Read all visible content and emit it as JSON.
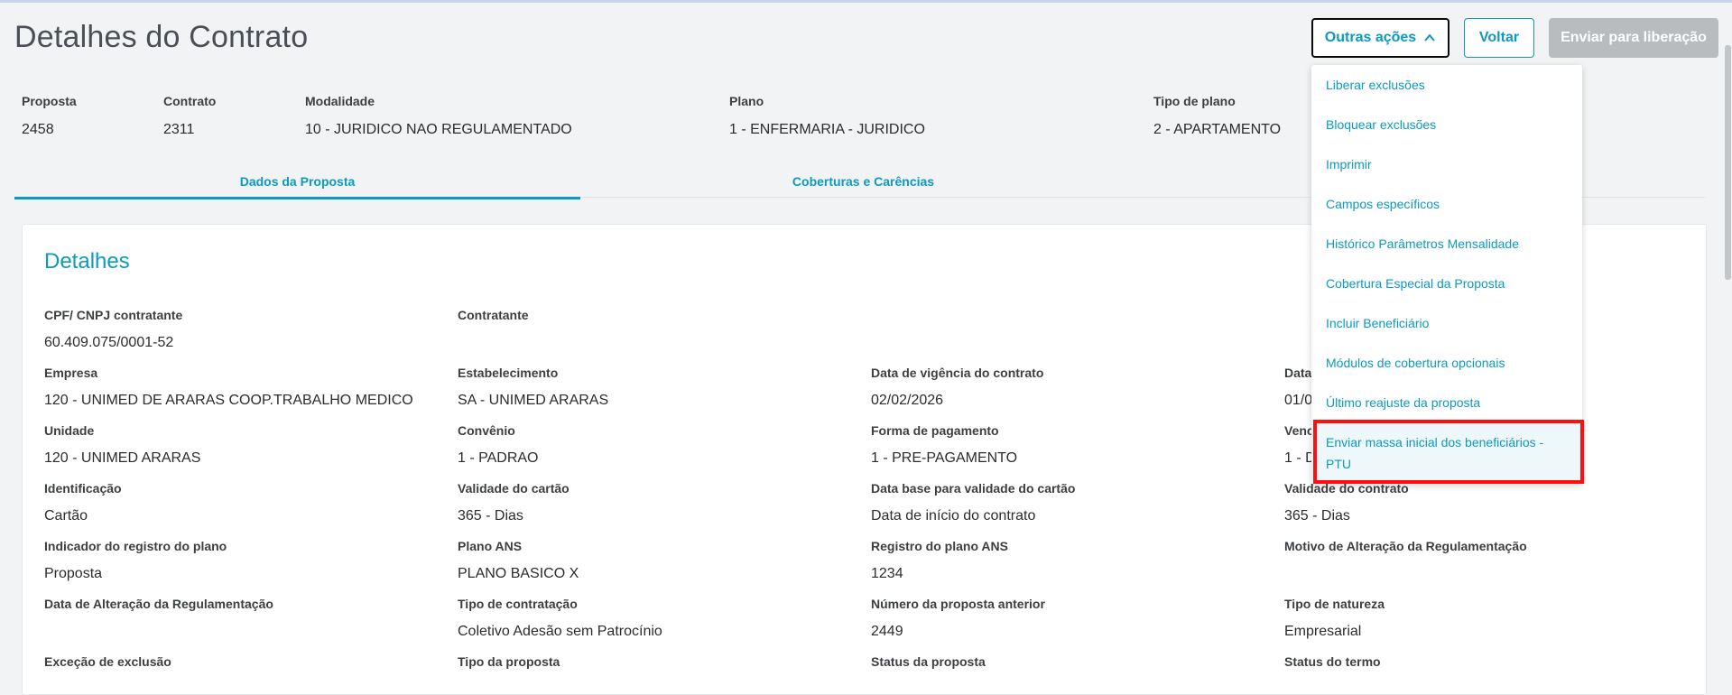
{
  "page_title": "Detalhes do Contrato",
  "actions": {
    "outras": "Outras ações",
    "voltar": "Voltar",
    "enviar": "Enviar para liberação"
  },
  "header_fields": [
    {
      "label": "Proposta",
      "value": "2458"
    },
    {
      "label": "Contrato",
      "value": "2311"
    },
    {
      "label": "Modalidade",
      "value": "10 - JURIDICO NAO REGULAMENTADO"
    },
    {
      "label": "Plano",
      "value": "1 - ENFERMARIA - JURIDICO"
    },
    {
      "label": "Tipo de plano",
      "value": "2 - APARTAMENTO"
    }
  ],
  "tabs": [
    {
      "label": "Dados da Proposta"
    },
    {
      "label": "Coberturas e Carências"
    }
  ],
  "detalhes": {
    "title": "Detalhes",
    "cpf_label": "CPF/ CNPJ contratante",
    "cpf_value": "60.409.075/0001-52",
    "contratante_label": "Contratante",
    "contratante_value": "",
    "empresa_label": "Empresa",
    "empresa_value": "120 - UNIMED DE ARARAS COOP.TRABALHO MEDICO",
    "estabelecimento_label": "Estabelecimento",
    "estabelecimento_value": "SA - UNIMED ARARAS",
    "vigencia_label": "Data de vigência do contrato",
    "vigencia_value": "02/02/2026",
    "data4_label": "Data",
    "data4_value": "01/0",
    "unidade_label": "Unidade",
    "unidade_value": "120 - UNIMED ARARAS",
    "convenio_label": "Convênio",
    "convenio_value": "1 - PADRAO",
    "pagamento_label": "Forma de pagamento",
    "pagamento_value": "1 - PRE-PAGAMENTO",
    "venc_label": "Venc",
    "venc_value": "1 - D",
    "identificacao_label": "Identificação",
    "identificacao_value": "Cartão",
    "validade_cartao_label": "Validade do cartão",
    "validade_cartao_value": "365 - Dias",
    "data_base_label": "Data base para validade do cartão",
    "data_base_value": "Data de início do contrato",
    "validade_contrato_label": "Validade do contrato",
    "validade_contrato_value": "365 - Dias",
    "indicador_label": "Indicador do registro do plano",
    "indicador_value": "Proposta",
    "plano_ans_label": "Plano ANS",
    "plano_ans_value": "PLANO BASICO X",
    "registro_ans_label": "Registro do plano ANS",
    "registro_ans_value": "1234",
    "motivo_label": "Motivo de Alteração da Regulamentação",
    "motivo_value": "",
    "data_alt_label": "Data de Alteração da Regulamentação",
    "data_alt_value": "",
    "tipo_contratacao_label": "Tipo de contratação",
    "tipo_contratacao_value": "Coletivo Adesão sem Patrocínio",
    "numero_anterior_label": "Número da proposta anterior",
    "numero_anterior_value": "2449",
    "tipo_natureza_label": "Tipo de natureza",
    "tipo_natureza_value": "Empresarial",
    "excecao_label": "Exceção de exclusão",
    "tipo_proposta_label": "Tipo da proposta",
    "status_proposta_label": "Status da proposta",
    "status_termo_label": "Status do termo"
  },
  "menu": [
    "Liberar exclusões",
    "Bloquear exclusões",
    "Imprimir",
    "Campos específicos",
    "Histórico Parâmetros Mensalidade",
    "Cobertura Especial da Proposta",
    "Incluir Beneficiário",
    "Módulos de cobertura opcionais",
    "Último reajuste da proposta",
    "Enviar massa inicial dos beneficiários - PTU"
  ],
  "colors": {
    "accent": "#0c9abe",
    "highlight_border": "#ff1010",
    "disabled": "#b9bcbf"
  }
}
